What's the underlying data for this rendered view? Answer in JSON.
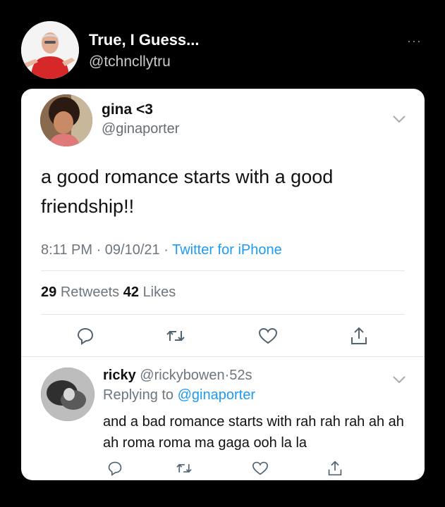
{
  "outer_tweet": {
    "display_name": "True, I Guess...",
    "handle": "@tchncllytru",
    "more_label": "···"
  },
  "quoted_tweet": {
    "display_name": "gina <3",
    "handle": "@ginaporter",
    "text": "a good romance starts with a good friendship!!",
    "time": "8:11 PM",
    "date": "09/10/21",
    "sep": "·",
    "source": "Twitter for iPhone",
    "retweets_count": "29",
    "retweets_label": "Retweets",
    "likes_count": "42",
    "likes_label": "Likes"
  },
  "reply": {
    "display_name": "ricky",
    "handle": "@rickybowen",
    "sep": "·",
    "age": "52s",
    "replying_prefix": "Replying to",
    "replying_to": "@ginaporter",
    "text": "and a bad romance starts with rah rah rah ah ah ah roma roma ma gaga ooh la la"
  },
  "icons": [
    "reply-icon",
    "retweet-icon",
    "like-icon",
    "share-icon",
    "chevron-down-icon",
    "more-icon"
  ],
  "colors": {
    "background": "#000000",
    "card": "#ffffff",
    "link": "#1d9bf0",
    "secondary_text": "#6e767d"
  }
}
